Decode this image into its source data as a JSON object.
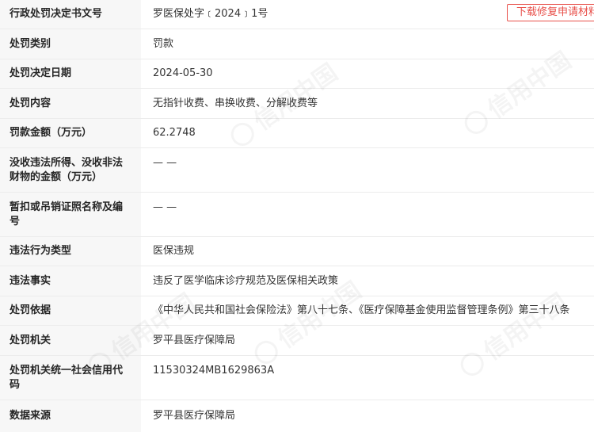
{
  "header": {
    "download_label": "下载修复申请材料"
  },
  "rows": [
    {
      "label": "行政处罚决定书文号",
      "value": "罗医保处字﹝2024﹞1号"
    },
    {
      "label": "处罚类别",
      "value": "罚款"
    },
    {
      "label": "处罚决定日期",
      "value": "2024-05-30"
    },
    {
      "label": "处罚内容",
      "value": "无指针收费、串换收费、分解收费等"
    },
    {
      "label": "罚款金额（万元）",
      "value": "62.2748"
    },
    {
      "label": "没收违法所得、没收非法财物的金额（万元）",
      "value": "— —"
    },
    {
      "label": "暂扣或吊销证照名称及编号",
      "value": "— —"
    },
    {
      "label": "违法行为类型",
      "value": "医保违规"
    },
    {
      "label": "违法事实",
      "value": "违反了医学临床诊疗规范及医保相关政策"
    },
    {
      "label": "处罚依据",
      "value": "《中华人民共和国社会保险法》第八十七条、《医疗保障基金使用监督管理条例》第三十八条"
    },
    {
      "label": "处罚机关",
      "value": "罗平县医疗保障局"
    },
    {
      "label": "处罚机关统一社会信用代码",
      "value": "11530324MB1629863A"
    },
    {
      "label": "数据来源",
      "value": "罗平县医疗保障局"
    }
  ],
  "watermark": {
    "text": "信用中国"
  }
}
